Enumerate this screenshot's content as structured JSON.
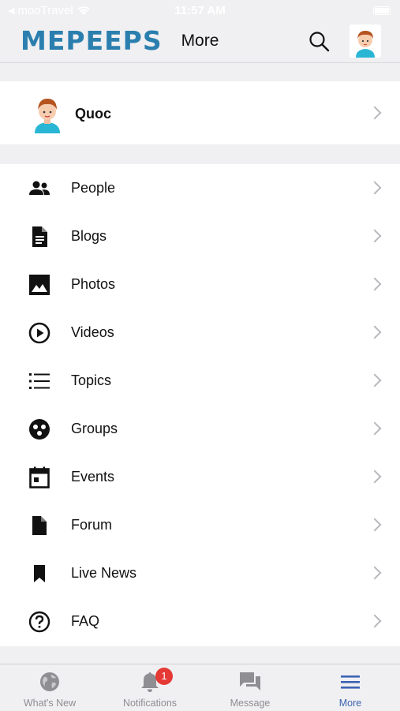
{
  "status_bar": {
    "carrier": "mooTravel",
    "time": "11:57 AM"
  },
  "header": {
    "logo_text": "MEPEEPS",
    "title": "More"
  },
  "profile": {
    "name": "Quoc"
  },
  "menu": {
    "items": [
      {
        "label": "People",
        "icon": "people-icon"
      },
      {
        "label": "Blogs",
        "icon": "document-icon"
      },
      {
        "label": "Photos",
        "icon": "image-icon"
      },
      {
        "label": "Videos",
        "icon": "play-circle-icon"
      },
      {
        "label": "Topics",
        "icon": "list-icon"
      },
      {
        "label": "Groups",
        "icon": "groups-icon"
      },
      {
        "label": "Events",
        "icon": "calendar-icon"
      },
      {
        "label": "Forum",
        "icon": "file-icon"
      },
      {
        "label": "Live News",
        "icon": "bookmark-icon"
      },
      {
        "label": "FAQ",
        "icon": "question-circle-icon"
      }
    ]
  },
  "tabbar": {
    "tabs": [
      {
        "label": "What's New",
        "icon": "globe-icon"
      },
      {
        "label": "Notifications",
        "icon": "bell-icon",
        "badge": "1"
      },
      {
        "label": "Message",
        "icon": "chat-icon"
      },
      {
        "label": "More",
        "icon": "menu-icon",
        "active": true
      }
    ]
  },
  "colors": {
    "accent": "#3b62b3",
    "logo": "#2b7fae",
    "badge": "#e53935"
  }
}
